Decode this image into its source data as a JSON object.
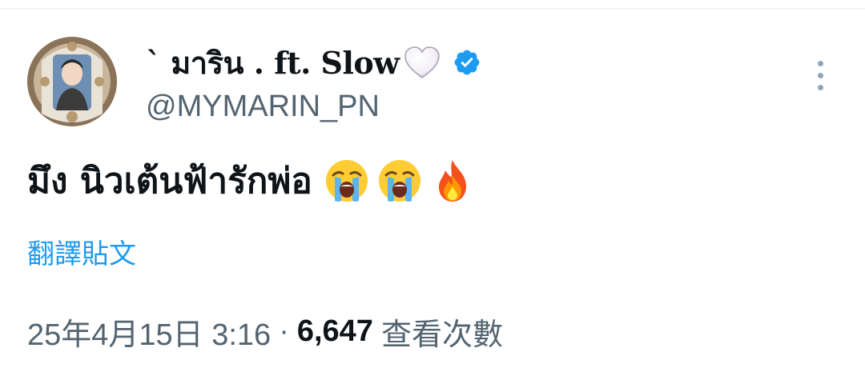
{
  "user": {
    "display_name": "` มาริน . ft. Slow",
    "handle": "@MYMARIN_PN",
    "verified": true
  },
  "tweet": {
    "text": "มึง นิวเต้นฟ้ารักพ่อ",
    "emojis": [
      "loudly-crying-face",
      "loudly-crying-face",
      "fire"
    ],
    "translate_label": "翻譯貼文"
  },
  "meta": {
    "timestamp": "25年4月15日 3:16",
    "separator": "·",
    "views_count": "6,647",
    "views_label": "查看次數"
  },
  "colors": {
    "accent": "#1d9bf0",
    "secondary_text": "#536471",
    "primary_text": "#0f1419",
    "verified": "#1d9bf0"
  }
}
